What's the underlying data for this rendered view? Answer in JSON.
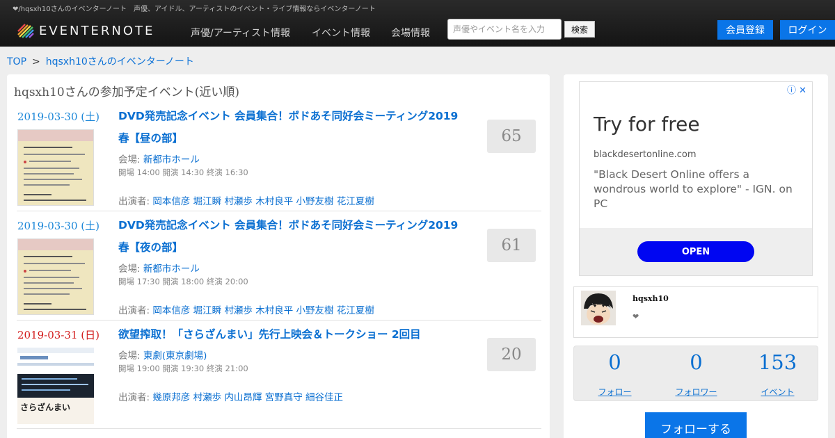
{
  "header": {
    "tagline": "❤/hqsxh10さんのイベンターノート　声優、アイドル、アーティストのイベント・ライブ情報ならイベンターノート",
    "logo_text": "EVENTERNOTE",
    "nav": [
      "声優/アーティスト情報",
      "イベント情報",
      "会場情報"
    ],
    "search_placeholder": "声優やイベント名を入力",
    "search_button": "検索",
    "register": "会員登録",
    "login": "ログイン"
  },
  "breadcrumb": {
    "home": "TOP",
    "separator": ">",
    "current": "hqsxh10さんのイベンターノート"
  },
  "main": {
    "section_title": "hqsxh10さんの参加予定イベント(近い順)",
    "venue_prefix": "会場: ",
    "cast_prefix": "出演者: ",
    "events": [
      {
        "date": "2019-03-30 (土)",
        "title": "DVD発売記念イベント 会員集合！ボドあそ同好会ミーティング2019春【昼の部】",
        "venue": "新都市ホール",
        "time": "開場 14:00 開演 14:30 終演 16:30",
        "cast": [
          "岡本信彦",
          "堀江瞬",
          "村瀬歩",
          "木村良平",
          "小野友樹",
          "花江夏樹"
        ],
        "count": "65"
      },
      {
        "date": "2019-03-30 (土)",
        "title": "DVD発売記念イベント 会員集合！ボドあそ同好会ミーティング2019春【夜の部】",
        "venue": "新都市ホール",
        "time": "開場 17:30 開演 18:00 終演 20:00",
        "cast": [
          "岡本信彦",
          "堀江瞬",
          "村瀬歩",
          "木村良平",
          "小野友樹",
          "花江夏樹"
        ],
        "count": "61"
      },
      {
        "date": "2019-03-31 (日)",
        "title": "欲望搾取！「さらざんまい」先行上映会＆トークショー 2回目",
        "venue": "東劇(東京劇場)",
        "time": "開場 19:00 開演 19:30 終演 21:00",
        "cast": [
          "幾原邦彦",
          "村瀬歩",
          "内山昂輝",
          "宮野真守",
          "細谷佳正"
        ],
        "count": "20",
        "thumb_text": "さらざんまい"
      }
    ]
  },
  "ad": {
    "headline": "Try for free",
    "domain": "blackdesertonline.com",
    "quote": "\"Black Desert Online offers a wondrous world to explore\" - IGN. on PC",
    "button": "OPEN",
    "info_icon": "ⓘ",
    "close_icon": "✕"
  },
  "profile": {
    "username": "hqsxh10",
    "bio": "❤"
  },
  "stats": [
    {
      "value": "0",
      "label": "フォロー"
    },
    {
      "value": "0",
      "label": "フォロワー"
    },
    {
      "value": "153",
      "label": "イベント"
    }
  ],
  "follow_button": "フォローする",
  "colors": {
    "accent": "#0a75e8",
    "link": "#0a6fd1",
    "sunday": "#d21a1a",
    "ad_button": "#0006f2"
  }
}
